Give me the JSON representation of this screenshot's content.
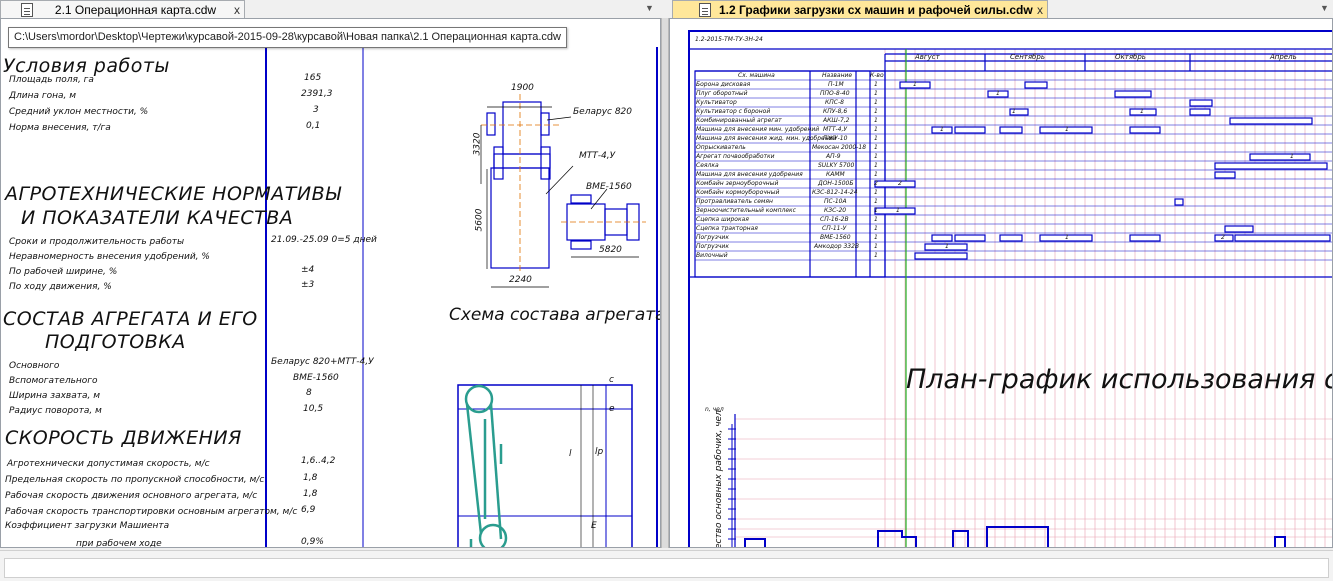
{
  "tabs": {
    "left": {
      "label": "2.1 Операционная карта.cdw",
      "close": "x",
      "dropdown": "▼"
    },
    "right": {
      "label": "1.2 Графики загрузки сх машин и рафочей силы.cdw",
      "close": "x",
      "dropdown": "▼"
    }
  },
  "tooltip": {
    "path": "C:\\Users\\mordor\\Desktop\\Чертежи\\курсавой-2015-09-28\\курсавой\\Новая папка\\2.1 Операционная карта.cdw"
  },
  "left_drawing": {
    "sections": {
      "conditions": "Условия работы",
      "agro_line1": "АГРОТЕХНИЧЕСКИЕ НОРМАТИВЫ",
      "agro_line2": "И ПОКАЗАТЕЛИ КАЧЕСТВА",
      "unit_line1": "СОСТАВ АГРЕГАТА И ЕГО",
      "unit_line2": "ПОДГОТОВКА",
      "speed": "СКОРОСТЬ ДВИЖЕНИЯ",
      "scheme": "Схема состава агрегата"
    },
    "conditions_rows": [
      {
        "label": "Площадь поля, га",
        "value": "165"
      },
      {
        "label": "Длина гона, м",
        "value": "2391,3"
      },
      {
        "label": "Средний уклон местности, %",
        "value": "3"
      },
      {
        "label": "Норма внесения, т/га",
        "value": "0,1"
      }
    ],
    "agro_rows": [
      {
        "label": "Сроки и продолжительность работы",
        "value": "21.09.-25.09 0=5 дней"
      },
      {
        "label": "Неравномерность внесения удобрений, %",
        "value": ""
      },
      {
        "label": "По рабочей ширине, %",
        "value": "±4"
      },
      {
        "label": "По ходу движения, %",
        "value": "±3"
      }
    ],
    "unit_rows": [
      {
        "label": "Основного",
        "value": "Беларус 820+МТТ-4,У"
      },
      {
        "label": "Вспомогательного",
        "value": "ВМЕ-1560"
      },
      {
        "label": "Ширина захвата, м",
        "value": "8"
      },
      {
        "label": "Радиус поворота, м",
        "value": "10,5"
      }
    ],
    "speed_rows": [
      {
        "label": "Агротехнически допустимая скорость, м/с",
        "value": "1,6..4,2"
      },
      {
        "label": "Предельная скорость по пропускной способности, м/с",
        "value": "1,8"
      },
      {
        "label": "Рабочая скорость движения основного агрегата, м/с",
        "value": "1,8"
      },
      {
        "label": "Рабочая скорость транспортировки основным агрегатом, м/с",
        "value": "6,9"
      },
      {
        "label": "Коэффициент загрузки Машиента",
        "value": ""
      },
      {
        "label": "при рабочем ходе",
        "value": "0,9%"
      }
    ],
    "dims": {
      "d1900": "1900",
      "d3320": "3320",
      "d5600": "5600",
      "d2240": "2240",
      "d5820": "5820"
    },
    "callouts": {
      "belarus": "Беларус 820",
      "mtt": "МТТ-4,У",
      "bme": "ВМЕ-1560"
    },
    "scheme_labels": {
      "l": "l",
      "lp": "lр",
      "e": "Е",
      "c": "с",
      "e2": "е"
    }
  },
  "right_drawing": {
    "corner_stamp": "1.2-2015-ТМ-ТУ-ЗН-24",
    "months": [
      "Август",
      "Сентябрь",
      "Октябрь",
      "Апрель"
    ],
    "headers": {
      "machine": "Сх. машина",
      "name": "Название",
      "qty": "К-во"
    },
    "rows": [
      {
        "machine": "Борона дисковая",
        "name": "П-1М",
        "qty": "1"
      },
      {
        "machine": "Плуг оборотный",
        "name": "ППО-8-40",
        "qty": "1"
      },
      {
        "machine": "Культиватор",
        "name": "КПС-8",
        "qty": "1"
      },
      {
        "machine": "Культиватор с бороной",
        "name": "КПУ-8,6",
        "qty": "1"
      },
      {
        "machine": "Комбинированный агрегат",
        "name": "АКШ-7,2",
        "qty": "1"
      },
      {
        "machine": "Машина для внесения мин. удобрений",
        "name": "МТТ-4,У",
        "qty": "1"
      },
      {
        "machine": "Машина для внесения жид. мин. удобрений",
        "name": "ПЖУ-10",
        "qty": "1"
      },
      {
        "machine": "Опрыскиватель",
        "name": "Мекосан 2000-18",
        "qty": "1"
      },
      {
        "machine": "Агрегат почвообработки",
        "name": "АП-9",
        "qty": "1"
      },
      {
        "machine": "Сеялка",
        "name": "SULKY 5700",
        "qty": "1"
      },
      {
        "machine": "Машина для внесения удобрения",
        "name": "КАММ",
        "qty": "1"
      },
      {
        "machine": "Комбайн зерноуборочный",
        "name": "ДОН-1500Б",
        "qty": "2"
      },
      {
        "machine": "Комбайн кормоуборочный",
        "name": "КЗС-812-14-24",
        "qty": "1"
      },
      {
        "machine": "Протравливатель семян",
        "name": "ПС-10А",
        "qty": "1"
      },
      {
        "machine": "Зерноочистительный комплекс",
        "name": "КЗС-20",
        "qty": "1"
      },
      {
        "machine": "Сцепка широкая",
        "name": "СП-16-2В",
        "qty": "1"
      },
      {
        "machine": "Сцепка тракторная",
        "name": "СП-11-У",
        "qty": "1"
      },
      {
        "machine": "Погрузчик",
        "name": "ВМЕ-1560",
        "qty": "1"
      },
      {
        "machine": "Погрузчик",
        "name": "Амкодор 332В",
        "qty": "1"
      },
      {
        "machine": "Вилочный",
        "name": "",
        "qty": "1"
      }
    ],
    "bar_label": "1",
    "bar_label2": "2",
    "title": "План-график использования сель",
    "yaxis_label": "Количество основных рабочих, чел",
    "axis_top": "n, чел"
  },
  "colors": {
    "blue": "#0000c8",
    "tab_active": "#ffe79a",
    "grid_pink": "#e8a0b0",
    "green": "#2a9d8f"
  }
}
